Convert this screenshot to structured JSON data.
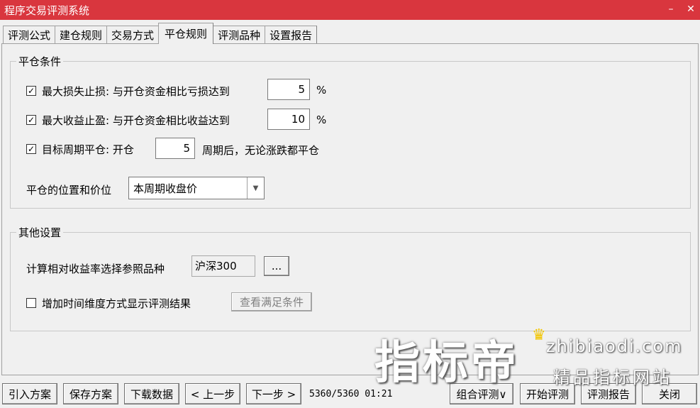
{
  "window": {
    "title": "程序交易评测系统"
  },
  "tabs": [
    {
      "label": "评测公式"
    },
    {
      "label": "建仓规则"
    },
    {
      "label": "交易方式"
    },
    {
      "label": "平仓规则"
    },
    {
      "label": "评测品种"
    },
    {
      "label": "设置报告"
    }
  ],
  "close_conditions": {
    "legend": "平仓条件",
    "max_loss": {
      "checked": "☑",
      "label": "最大损失止损: 与开仓资金相比亏损达到",
      "value": "5",
      "unit": "%"
    },
    "max_profit": {
      "checked": "☑",
      "label": "最大收益止盈: 与开仓资金相比收益达到",
      "value": "10",
      "unit": "%"
    },
    "target_period": {
      "checked": "☑",
      "label": "目标周期平仓: 开仓",
      "value": "5",
      "suffix": "周期后，无论涨跌都平仓"
    },
    "position_price": {
      "label": "平仓的位置和价位",
      "selected": "本周期收盘价"
    }
  },
  "other_settings": {
    "legend": "其他设置",
    "benchmark": {
      "label": "计算相对收益率选择参照品种",
      "value": "沪深300",
      "browse": "..."
    },
    "time_dimension": {
      "label": "增加时间维度方式显示评测结果",
      "view_button": "查看满足条件"
    }
  },
  "bottom": {
    "import": "引入方案",
    "save": "保存方案",
    "download": "下载数据",
    "prev": "< 上一步",
    "next": "下一步 >",
    "status": "5360/5360  01:21",
    "combo": "组合评测∨",
    "start": "开始评测",
    "report": "评测报告",
    "close": "关闭"
  },
  "watermark": {
    "brand": "指标帝",
    "url": "zhibiaodi.com",
    "slogan": "精品指标网站"
  }
}
